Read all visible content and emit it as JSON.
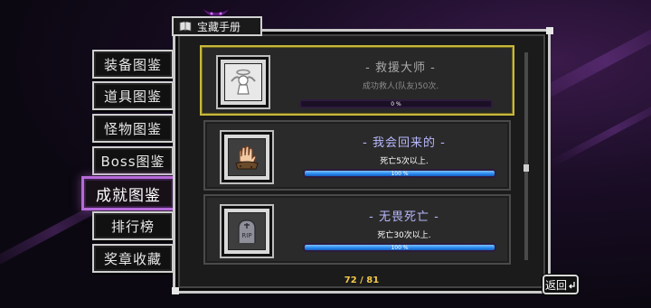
{
  "window": {
    "title": "宝藏手册",
    "title_icon": "book-icon"
  },
  "sidebar": {
    "items": [
      {
        "label": "装备图鉴",
        "active": false
      },
      {
        "label": "道具图鉴",
        "active": false
      },
      {
        "label": "怪物图鉴",
        "active": false
      },
      {
        "label": "Boss图鉴",
        "active": false
      },
      {
        "label": "成就图鉴",
        "active": true
      },
      {
        "label": "排行榜",
        "active": false
      },
      {
        "label": "奖章收藏",
        "active": false
      }
    ]
  },
  "achievements": [
    {
      "title": "- 救援大师 -",
      "description": "成功救人(队友)50次.",
      "progress": 0,
      "progress_label": "0 %",
      "locked": true,
      "icon": "angel-icon"
    },
    {
      "title": "- 我会回来的 -",
      "description": "死亡5次以上.",
      "progress": 1,
      "progress_label": "100 %",
      "locked": false,
      "icon": "hand-from-ground-icon"
    },
    {
      "title": "- 无畏死亡 -",
      "description": "死亡30次以上.",
      "progress": 1,
      "progress_label": "100 %",
      "locked": false,
      "icon": "rip-tombstone-icon"
    }
  ],
  "pagination": {
    "text": "72 / 81"
  },
  "back_button": {
    "label": "返回",
    "icon": "return-arrow-icon"
  },
  "colors": {
    "accent_purple": "#b66ad8",
    "title_blue": "#b8b8ff",
    "locked_border": "#c8b83a",
    "page_count": "#f2c84b",
    "bar_blue": "#2a8cf0"
  }
}
